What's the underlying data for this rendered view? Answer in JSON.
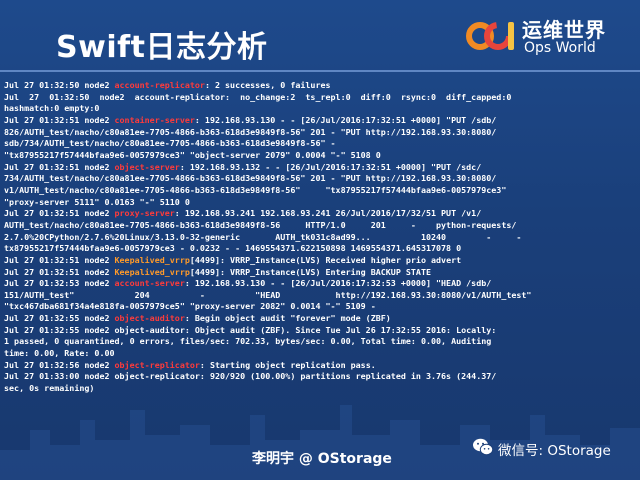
{
  "slide": {
    "title": "Swift日志分析",
    "logo": {
      "cn": "运维世界",
      "en": "Ops World"
    },
    "footer": {
      "author": "李明宇 @ OStorage",
      "wechat": "微信号: OStorage"
    },
    "log_lines": [
      [
        {
          "t": "Jul 27 01:32:50 node2 "
        },
        {
          "t": "account-replicator",
          "c": "red"
        },
        {
          "t": ": 2 successes, 0 failures"
        }
      ],
      [
        {
          "t": "Jul  27  01:32:50  node2  account-replicator:  no_change:2  ts_repl:0  diff:0  rsync:0  diff_capped:0"
        }
      ],
      [
        {
          "t": "hashmatch:0 empty:0"
        }
      ],
      [
        {
          "t": "Jul 27 01:32:51 node2 "
        },
        {
          "t": "container-server",
          "c": "red"
        },
        {
          "t": ": 192.168.93.130 - - [26/Jul/2016:17:32:51 +0000] \"PUT /sdb/"
        }
      ],
      [
        {
          "t": "826/AUTH_test/nacho/c80a81ee-7705-4866-b363-618d3e9849f8-56\" 201 - \"PUT http://192.168.93.30:8080/"
        }
      ],
      [
        {
          "t": "sdb/734/AUTH_test/nacho/c80a81ee-7705-4866-b363-618d3e9849f8-56\" -"
        }
      ],
      [
        {
          "t": "\"tx87955217f57444bfaa9e6-0057979ce3\" \"object-server 2079\" 0.0004 \"-\" 5108 0"
        }
      ],
      [
        {
          "t": "Jul 27 01:32:51 node2 "
        },
        {
          "t": "object-server",
          "c": "red"
        },
        {
          "t": ": 192.168.93.132 - - [26/Jul/2016:17:32:51 +0000] \"PUT /sdc/"
        }
      ],
      [
        {
          "t": "734/AUTH_test/nacho/c80a81ee-7705-4866-b363-618d3e9849f8-56\" 201 - \"PUT http://192.168.93.30:8080/"
        }
      ],
      [
        {
          "t": "v1/AUTH_test/nacho/c80a81ee-7705-4866-b363-618d3e9849f8-56\"     \"tx87955217f57444bfaa9e6-0057979ce3\""
        }
      ],
      [
        {
          "t": "\"proxy-server 5111\" 0.0163 \"-\" 5110 0"
        }
      ],
      [
        {
          "t": "Jul 27 01:32:51 node2 "
        },
        {
          "t": "proxy-server",
          "c": "red"
        },
        {
          "t": ": 192.168.93.241 192.168.93.241 26/Jul/2016/17/32/51 PUT /v1/"
        }
      ],
      [
        {
          "t": "AUTH_test/nacho/c80a81ee-7705-4866-b363-618d3e9849f8-56     HTTP/1.0     201     -    python-requests/"
        }
      ],
      [
        {
          "t": "2.7.0%20CPython/2.7.6%20Linux/3.13.0-32-generic       AUTH_tk031c8ad99...          10240        -     -"
        }
      ],
      [
        {
          "t": "tx87955217f57444bfaa9e6-0057979ce3 - 0.0232 - - 1469554371.622150898 1469554371.645317078 0"
        }
      ],
      [
        {
          "t": "Jul 27 01:32:51 node2 "
        },
        {
          "t": "Keepalived_vrrp",
          "c": "orange"
        },
        {
          "t": "[4499]: VRRP_Instance(LVS) Received higher prio advert"
        }
      ],
      [
        {
          "t": "Jul 27 01:32:51 node2 "
        },
        {
          "t": "Keepalived_vrrp",
          "c": "orange"
        },
        {
          "t": "[4499]: VRRP_Instance(LVS) Entering BACKUP STATE"
        }
      ],
      [
        {
          "t": "Jul 27 01:32:53 node2 "
        },
        {
          "t": "account-server",
          "c": "red"
        },
        {
          "t": ": 192.168.93.130 - - [26/Jul/2016:17:32:53 +0000] \"HEAD /sdb/"
        }
      ],
      [
        {
          "t": "151/AUTH_test\"            204          -          \"HEAD           http://192.168.93.30:8080/v1/AUTH_test\""
        }
      ],
      [
        {
          "t": "\"txc467dba681f34a4e818fa-0057979ce5\" \"proxy-server 2082\" 0.0014 \"-\" 5109 -"
        }
      ],
      [
        {
          "t": "Jul 27 01:32:55 node2 "
        },
        {
          "t": "object-auditor",
          "c": "red"
        },
        {
          "t": ": Begin object audit \"forever\" mode (ZBF)"
        }
      ],
      [
        {
          "t": "Jul 27 01:32:55 node2 object-auditor: Object audit (ZBF). Since Tue Jul 26 17:32:55 2016: Locally:"
        }
      ],
      [
        {
          "t": "1 passed, 0 quarantined, 0 errors, files/sec: 702.33, bytes/sec: 0.00, Total time: 0.00, Auditing"
        }
      ],
      [
        {
          "t": "time: 0.00, Rate: 0.00"
        }
      ],
      [
        {
          "t": "Jul 27 01:32:56 node2 "
        },
        {
          "t": "object-replicator",
          "c": "red"
        },
        {
          "t": ": Starting object replication pass."
        }
      ],
      [
        {
          "t": "Jul 27 01:33:00 node2 object-replicator: 920/920 (100.00%) partitions replicated in 3.76s (244.37/"
        }
      ],
      [
        {
          "t": "sec, 0s remaining)"
        }
      ]
    ],
    "colors": {
      "background": "#1c3f78",
      "highlight_red": "#ff3b3b",
      "highlight_orange": "#ff9a2a",
      "text": "#ffffff"
    }
  }
}
